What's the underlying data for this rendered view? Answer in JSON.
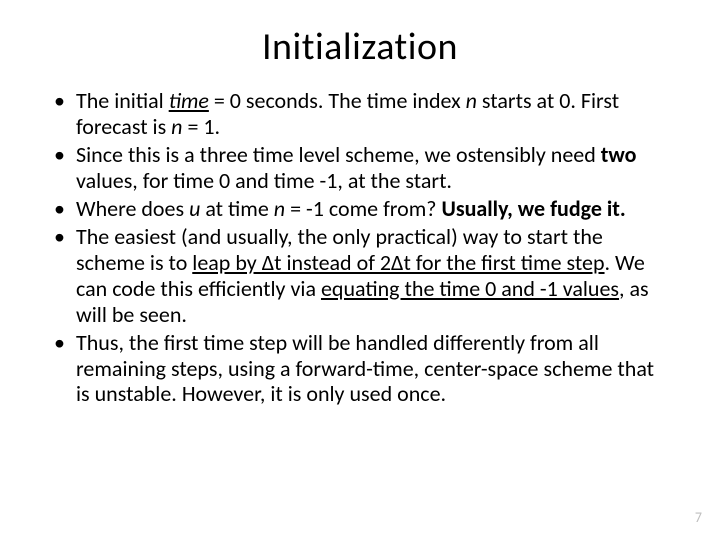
{
  "title": "Initialization",
  "bullets": {
    "b1": {
      "p1": "The initial ",
      "p2": "time",
      "p3": " = 0 seconds.  The time index ",
      "p4": "n",
      "p5": " starts at 0.  First forecast is ",
      "p6": "n",
      "p7": " = 1."
    },
    "b2": {
      "p1": "Since this is a three time level scheme, we ostensibly need ",
      "p2": "two",
      "p3": " values, for time 0 and time -1, at the start."
    },
    "b3": {
      "p1": "Where does ",
      "p2": "u",
      "p3": " at time ",
      "p4": "n",
      "p5": " = -1 come from?  ",
      "p6": "Usually, we fudge it."
    },
    "b4": {
      "p1": "The easiest (and usually, the only practical) way to start the scheme is to ",
      "p2": "leap by Δt instead of 2Δt for the first time step",
      "p3": ".  We can code this efficiently via ",
      "p4": "equating the time 0 and -1 values",
      "p5": ", as will be seen."
    },
    "b5": {
      "p1": "Thus, the first time step will be handled differently from all remaining steps, using a forward-time, center-space scheme that is unstable.  However, it is only used once."
    }
  },
  "page_number": "7"
}
